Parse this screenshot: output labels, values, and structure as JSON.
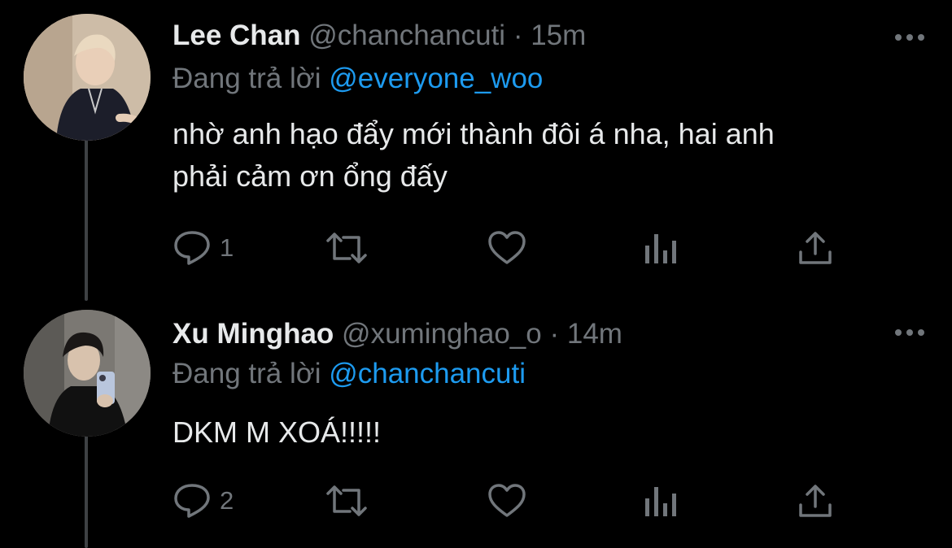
{
  "tweets": [
    {
      "name": "Lee Chan",
      "handle": "@chanchancuti",
      "dot": "·",
      "time": "15m",
      "reply_prefix": "Đang trả lời",
      "reply_to": "@everyone_woo",
      "text_line1": "nhờ anh hạo đẩy mới thành đôi á nha, hai anh",
      "text_line2": "phải cảm ơn ổng đấy",
      "reply_count": "1"
    },
    {
      "name": "Xu Minghao",
      "handle": "@xuminghao_o",
      "dot": "·",
      "time": "14m",
      "reply_prefix": "Đang trả lời",
      "reply_to": "@chanchancuti",
      "text_line1": "DKM M XOÁ!!!!!",
      "reply_count": "2"
    }
  ],
  "icons": [
    "more-icon",
    "reply-icon",
    "retweet-icon",
    "like-icon",
    "views-icon",
    "share-icon"
  ],
  "colors": {
    "background": "#000000",
    "text": "#e7e9ea",
    "muted": "#71767b",
    "link": "#1d9bf0"
  }
}
